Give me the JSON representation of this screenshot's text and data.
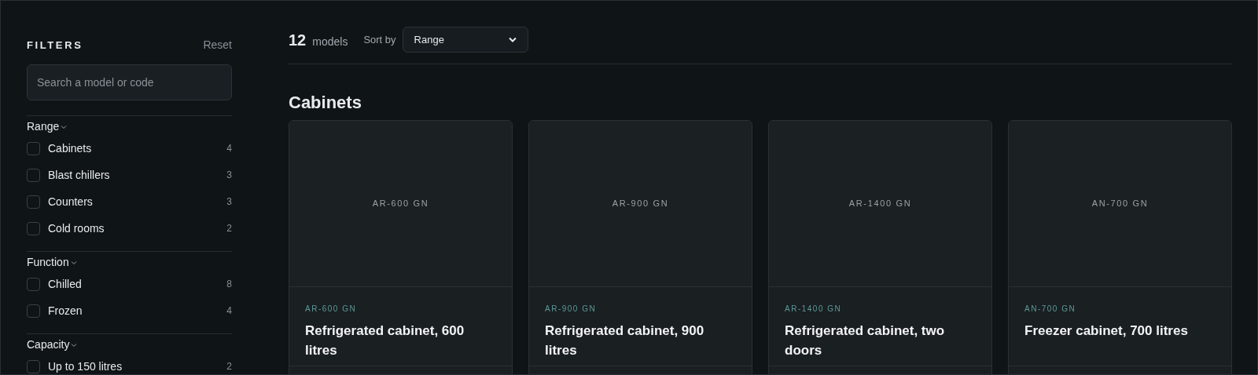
{
  "sidebar": {
    "title": "FILTERS",
    "reset": "Reset",
    "search": {
      "placeholder": "Search a model or code"
    },
    "groups": [
      {
        "label": "Range",
        "expanded": true,
        "options": [
          {
            "label": "Cabinets",
            "count": "4",
            "checked": false
          },
          {
            "label": "Blast chillers",
            "count": "3",
            "checked": false
          },
          {
            "label": "Counters",
            "count": "3",
            "checked": false
          },
          {
            "label": "Cold rooms",
            "count": "2",
            "checked": false
          }
        ]
      },
      {
        "label": "Function",
        "expanded": true,
        "options": [
          {
            "label": "Chilled",
            "count": "8",
            "checked": false
          },
          {
            "label": "Frozen",
            "count": "4",
            "checked": false
          }
        ]
      },
      {
        "label": "Capacity",
        "expanded": true,
        "options": [
          {
            "label": "Up to 150 litres",
            "count": "2",
            "checked": false
          }
        ]
      }
    ]
  },
  "toolbar": {
    "count": "12",
    "count_label": "models",
    "sort_label": "Sort by",
    "sort_value": "Range"
  },
  "section": {
    "title": "Cabinets",
    "products": [
      {
        "image_code": "AR-600 GN",
        "code": "AR-600 GN",
        "name": "Refrigerated cabinet, 600 litres"
      },
      {
        "image_code": "AR-900 GN",
        "code": "AR-900 GN",
        "name": "Refrigerated cabinet, 900 litres"
      },
      {
        "image_code": "AR-1400 GN",
        "code": "AR-1400 GN",
        "name": "Refrigerated cabinet, two doors"
      },
      {
        "image_code": "AN-700 GN",
        "code": "AN-700 GN",
        "name": "Freezer cabinet, 700 litres"
      }
    ]
  }
}
